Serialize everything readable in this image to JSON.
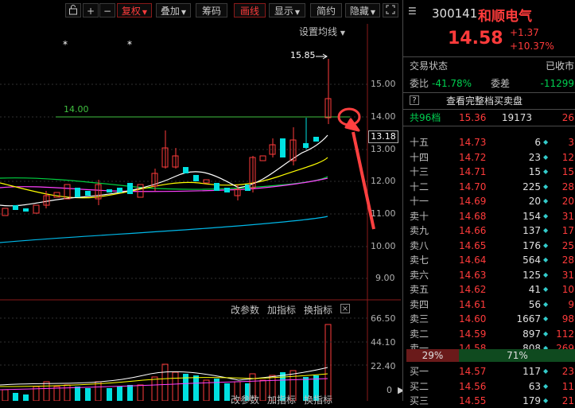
{
  "toolbar": {
    "lock_icon": "lock-icon",
    "plus": "+",
    "minus": "−",
    "fuquan": "复权",
    "diejia": "叠加",
    "chouma": "筹码",
    "huaxian": "画线",
    "xianshi": "显示",
    "jianyue": "简约",
    "yincang": "隐藏",
    "expand_icon": "expand-icon"
  },
  "main_chart": {
    "settings_label": "设置均线",
    "high_label": "15.85",
    "line_label": "14.00",
    "axis_ticks": [
      "15.00",
      "14.00",
      "13.18",
      "13.00",
      "12.00",
      "11.00",
      "10.00",
      "9.00"
    ],
    "star_marker": "*"
  },
  "sub_chart": {
    "params_label": "改参数",
    "add_label": "加指标",
    "switch_label": "换指标",
    "close_label": "×",
    "axis_ticks": [
      "66.50",
      "44.10",
      "22.40",
      "0"
    ],
    "bottom_labels": [
      "改参数",
      "加指标",
      "换指标"
    ]
  },
  "quote": {
    "code": "300141",
    "name": "和顺电气",
    "price": "14.58",
    "change": "+1.37",
    "change_pct": "+10.37%",
    "status_label": "交易状态",
    "status_value": "已收市",
    "weibi_label": "委比",
    "weibi_value": "-41.78%",
    "weicha_label": "委差",
    "weicha_value": "-11299",
    "full_book_label": "查看完整档买卖盘",
    "book_icon": "?",
    "total_label": "共96档",
    "total_price": "15.36",
    "total_vol": "19173",
    "total_chg": "26",
    "asks": [
      {
        "label": "十五",
        "price": "14.73",
        "vol": "6",
        "mark": "◆",
        "chg": "3"
      },
      {
        "label": "十四",
        "price": "14.72",
        "vol": "23",
        "mark": "◆",
        "chg": "12"
      },
      {
        "label": "十三",
        "price": "14.71",
        "vol": "15",
        "mark": "◆",
        "chg": "15"
      },
      {
        "label": "十二",
        "price": "14.70",
        "vol": "225",
        "mark": "◆",
        "chg": "28"
      },
      {
        "label": "十一",
        "price": "14.69",
        "vol": "20",
        "mark": "◆",
        "chg": "20"
      },
      {
        "label": "卖十",
        "price": "14.68",
        "vol": "154",
        "mark": "◆",
        "chg": "31"
      },
      {
        "label": "卖九",
        "price": "14.66",
        "vol": "137",
        "mark": "◆",
        "chg": "17"
      },
      {
        "label": "卖八",
        "price": "14.65",
        "vol": "176",
        "mark": "◆",
        "chg": "25"
      },
      {
        "label": "卖七",
        "price": "14.64",
        "vol": "564",
        "mark": "◆",
        "chg": "28"
      },
      {
        "label": "卖六",
        "price": "14.63",
        "vol": "125",
        "mark": "◆",
        "chg": "31"
      },
      {
        "label": "卖五",
        "price": "14.62",
        "vol": "41",
        "mark": "◆",
        "chg": "10"
      },
      {
        "label": "卖四",
        "price": "14.61",
        "vol": "56",
        "mark": "◆",
        "chg": "9"
      },
      {
        "label": "卖三",
        "price": "14.60",
        "vol": "1667",
        "mark": "◆",
        "chg": "98"
      },
      {
        "label": "卖二",
        "price": "14.59",
        "vol": "897",
        "mark": "◆",
        "chg": "112"
      },
      {
        "label": "卖一",
        "price": "14.58",
        "vol": "808",
        "mark": "◆",
        "chg": "269"
      }
    ],
    "ratio_left": "29%",
    "ratio_right": "71%",
    "bids": [
      {
        "label": "买一",
        "price": "14.57",
        "vol": "117",
        "mark": "◆",
        "chg": "23"
      },
      {
        "label": "买二",
        "price": "14.56",
        "vol": "63",
        "mark": "◆",
        "chg": "11"
      },
      {
        "label": "买三",
        "price": "14.55",
        "vol": "179",
        "mark": "◆",
        "chg": "21"
      }
    ]
  },
  "colors": {
    "up": "#ff3b3b",
    "down": "#00e0e0",
    "ma1": "#ffffff",
    "ma2": "#ffff00",
    "ma3": "#ff40ff",
    "ma4": "#00ff00",
    "ma5": "#00c0ff",
    "annotation": "#ff4040"
  }
}
